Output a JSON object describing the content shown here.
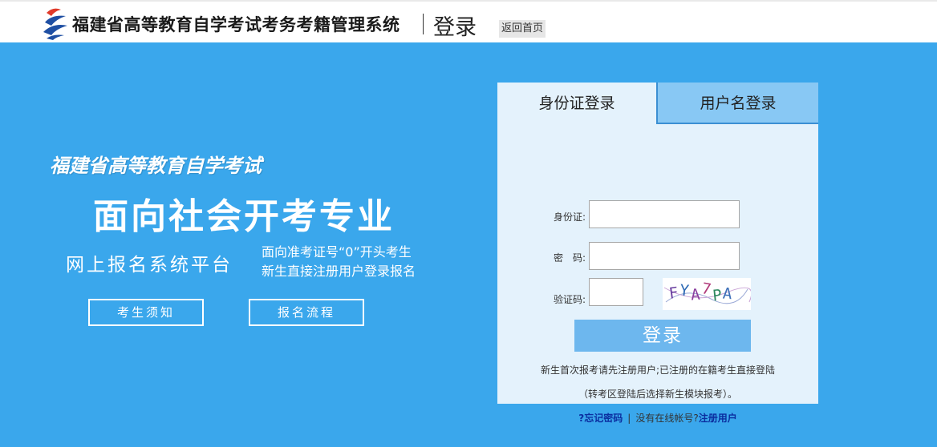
{
  "header": {
    "site_title": "福建省高等教育自学考试考务考籍管理系统",
    "login_word": "登录",
    "home_button": "返回首页"
  },
  "banner": {
    "slogan_1": "福建省高等教育自学考试",
    "slogan_2": "面向社会开考专业",
    "slogan_3": "网上报名系统平台",
    "note_line_1": "面向准考证号“0”开头考生",
    "note_line_2": "新生直接注册用户登录报名",
    "buttons": {
      "notice": "考生须知",
      "process": "报名流程"
    }
  },
  "login_panel": {
    "tabs": {
      "id_card": "身份证登录",
      "username": "用户名登录"
    },
    "active_tab": "id_card",
    "fields": {
      "id_label": "身份证:",
      "id_value": "",
      "password_label": "密　码:",
      "password_value": "",
      "captcha_label": "验证码:",
      "captcha_value": ""
    },
    "captcha_image": {
      "chars": [
        "F",
        "Y",
        "A",
        "7",
        "P",
        "A"
      ],
      "colors": [
        "#6a3fa0",
        "#2f6bb5",
        "#8a3d9e",
        "#b03a7a",
        "#2f8a60",
        "#3c6fb8"
      ]
    },
    "submit_label": "登录",
    "hint_line_1": "新生首次报考请先注册用户;已注册的在籍考生直接登陆",
    "hint_line_2": "（转考区登陆后选择新生模块报考）。",
    "forgot_password": "?忘记密码",
    "no_account": "没有在线帐号?",
    "register": "注册用户"
  },
  "colors": {
    "banner_bg": "#3aa7ec",
    "panel_bg": "#e4f2fc",
    "inactive_tab_bg": "#88c8f4",
    "submit_bg": "#6db7ee",
    "link_color": "#0b2ea0"
  }
}
